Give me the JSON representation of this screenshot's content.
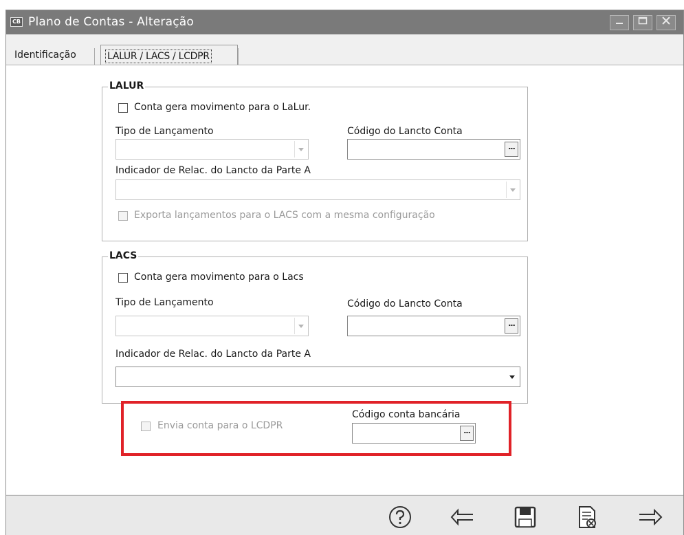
{
  "window": {
    "app_icon_text": "CB",
    "title": "Plano de Contas - Alteração",
    "controls": [
      "minimize-icon",
      "maximize-icon",
      "close-icon"
    ]
  },
  "tabs": [
    {
      "label": "Identificação",
      "active": false
    },
    {
      "label": "LALUR / LACS / LCDPR",
      "active": true
    }
  ],
  "lalur": {
    "title": "LALUR",
    "checkbox_label": "Conta gera movimento para o LaLur.",
    "tipo_label": "Tipo de Lançamento",
    "tipo_value": "",
    "codigo_label": "Código do Lancto Conta",
    "codigo_value": "",
    "indicador_label": "Indicador de Relac. do Lancto da Parte A",
    "indicador_value": "",
    "exporta_label": "Exporta lançamentos para o LACS com a mesma configuração"
  },
  "lacs": {
    "title": "LACS",
    "checkbox_label": "Conta gera movimento para o Lacs",
    "tipo_label": "Tipo de Lançamento",
    "tipo_value": "",
    "codigo_label": "Código do Lancto Conta",
    "codigo_value": "",
    "indicador_label": "Indicador de Relac. do Lancto da Parte A",
    "indicador_value": ""
  },
  "lcdpr": {
    "checkbox_label": "Envia conta para o LCDPR",
    "codigo_label": "Código conta bancária",
    "codigo_value": "",
    "highlight_color": "#e02228"
  },
  "lookup_button_text": "...",
  "toolbar": {
    "buttons": [
      "help-icon",
      "back-arrow-icon",
      "save-icon",
      "cancel-document-icon",
      "forward-arrow-icon"
    ]
  }
}
